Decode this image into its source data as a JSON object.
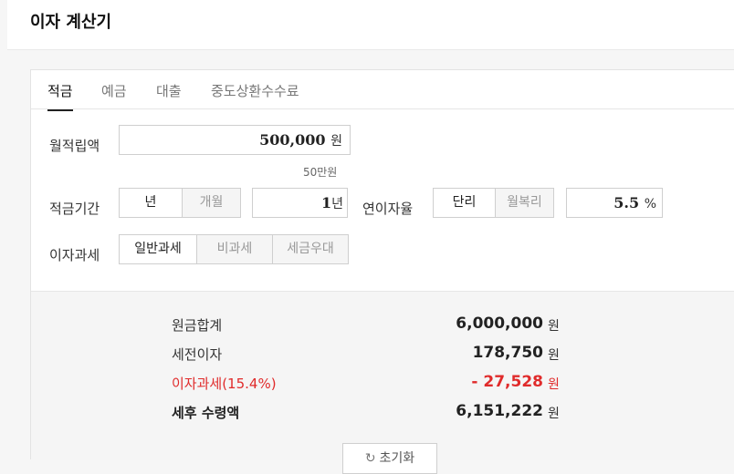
{
  "page": {
    "title": "이자 계산기"
  },
  "tabs": [
    {
      "label": "적금",
      "active": true
    },
    {
      "label": "예금",
      "active": false
    },
    {
      "label": "대출",
      "active": false
    },
    {
      "label": "중도상환수수료",
      "active": false
    }
  ],
  "form": {
    "monthly_deposit": {
      "label": "월적립액",
      "value": "500,000",
      "unit": "원",
      "hint": "50만원"
    },
    "period": {
      "label": "적금기간",
      "unit_options": [
        {
          "label": "년",
          "selected": true
        },
        {
          "label": "개월",
          "selected": false
        }
      ],
      "value": "1",
      "unit": "년"
    },
    "rate": {
      "label": "연이자율",
      "type_options": [
        {
          "label": "단리",
          "selected": true
        },
        {
          "label": "월복리",
          "selected": false
        }
      ],
      "value": "5.5",
      "unit": "%"
    },
    "tax": {
      "label": "이자과세",
      "options": [
        {
          "label": "일반과세",
          "selected": true
        },
        {
          "label": "비과세",
          "selected": false
        },
        {
          "label": "세금우대",
          "selected": false
        }
      ]
    }
  },
  "results": {
    "rows": [
      {
        "label": "원금합계",
        "value": "6,000,000",
        "unit": "원"
      },
      {
        "label": "세전이자",
        "value": "178,750",
        "unit": "원"
      },
      {
        "label": "이자과세(15.4%)",
        "value": "- 27,528",
        "unit": "원"
      },
      {
        "label": "세후 수령액",
        "value": "6,151,222",
        "unit": "원"
      }
    ],
    "reset_label": "초기화"
  },
  "colors": {
    "accent_red": "#e02b2b",
    "text": "#222222",
    "muted": "#999999"
  }
}
